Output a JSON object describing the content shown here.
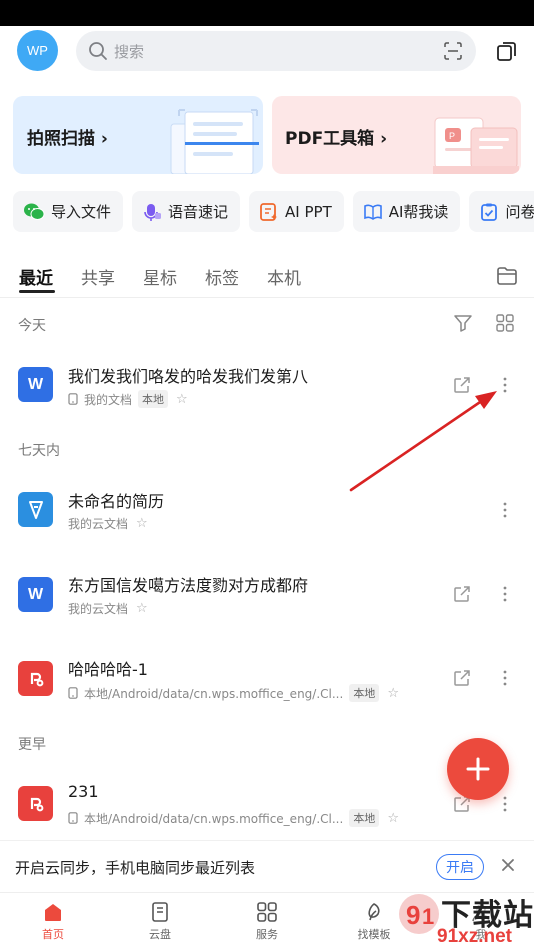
{
  "header": {
    "avatar_text": "WP",
    "search_placeholder": "搜索"
  },
  "cards": {
    "scan_label": "拍照扫描 ›",
    "pdf_label": "PDF工具箱 ›"
  },
  "tools": [
    "导入文件",
    "语音速记",
    "AI PPT",
    "AI帮我读",
    "问卷"
  ],
  "tabs": [
    "最近",
    "共享",
    "星标",
    "标签",
    "本机"
  ],
  "sections": {
    "today": "今天",
    "week": "七天内",
    "earlier": "更早"
  },
  "files": [
    {
      "name": "我们发我们咯发的哈发我们发第八",
      "location": "我的文档",
      "tag": "本地",
      "type": "word"
    },
    {
      "name": "未命名的简历",
      "location": "我的云文档",
      "tag": "",
      "type": "resume"
    },
    {
      "name": "东方国信发噶方法度勠对方成都府",
      "location": "我的云文档",
      "tag": "",
      "type": "word"
    },
    {
      "name": "哈哈哈哈-1",
      "location": "本地/Android/data/cn.wps.moffice_eng/.Cl...",
      "tag": "本地",
      "type": "pdf"
    },
    {
      "name": "231",
      "location": "本地/Android/data/cn.wps.moffice_eng/.Cl...",
      "tag": "本地",
      "type": "pdf"
    }
  ],
  "banner": {
    "text": "开启云同步，手机电脑同步最近列表",
    "button": "开启"
  },
  "nav": [
    "首页",
    "云盘",
    "服务",
    "找模板",
    "我"
  ],
  "watermark": {
    "text": "下载站",
    "url": "91xz.net"
  },
  "colors": {
    "accent": "#ec4a3d",
    "link": "#3a7bf5",
    "word": "#2f6fe4",
    "pdf": "#e8413d"
  }
}
